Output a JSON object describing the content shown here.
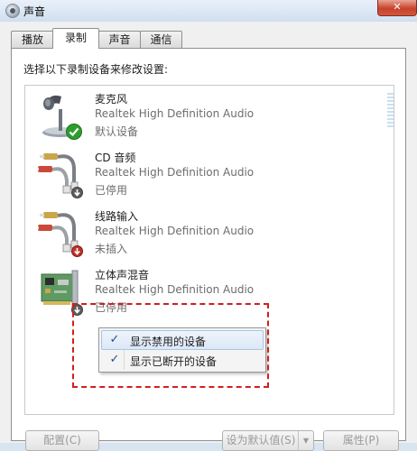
{
  "window": {
    "title": "声音",
    "close_label": "✕"
  },
  "tabs": [
    {
      "label": "播放",
      "active": false
    },
    {
      "label": "录制",
      "active": true
    },
    {
      "label": "声音",
      "active": false
    },
    {
      "label": "通信",
      "active": false
    }
  ],
  "instruction": "选择以下录制设备来修改设置:",
  "devices": [
    {
      "name": "麦克风",
      "description": "Realtek High Definition Audio",
      "status": "默认设备",
      "icon": "microphone-icon",
      "badge": "green-check-badge"
    },
    {
      "name": "CD 音频",
      "description": "Realtek High Definition Audio",
      "status": "已停用",
      "icon": "rca-cable-icon",
      "badge": "gray-down-arrow-badge"
    },
    {
      "name": "线路输入",
      "description": "Realtek High Definition Audio",
      "status": "未插入",
      "icon": "rca-cable-icon",
      "badge": "red-down-arrow-badge"
    },
    {
      "name": "立体声混音",
      "description": "Realtek High Definition Audio",
      "status": "已停用",
      "icon": "sound-card-icon",
      "badge": "gray-down-arrow-badge"
    }
  ],
  "context_menu": [
    {
      "label": "显示禁用的设备",
      "checked": true,
      "check_glyph": "✓"
    },
    {
      "label": "显示已断开的设备",
      "checked": true,
      "check_glyph": "✓"
    }
  ],
  "buttons": {
    "configure": "配置(C)",
    "set_default": "设为默认值(S)",
    "properties": "属性(P)"
  },
  "colors": {
    "accent": "#3c78c8",
    "highlight_border": "#d21e1e",
    "status_ok": "#2f9e2f",
    "status_error": "#c0312a"
  }
}
